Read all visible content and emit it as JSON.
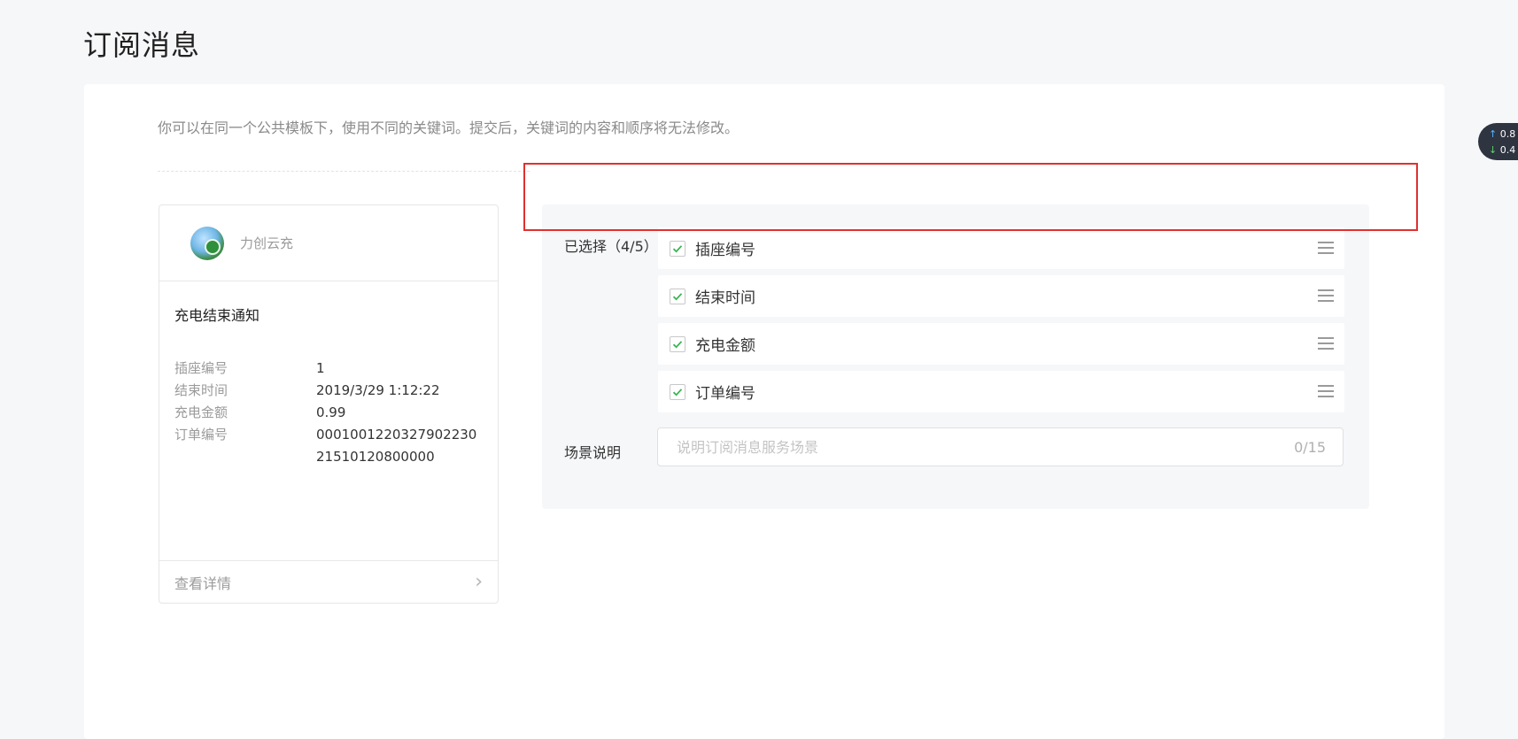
{
  "page": {
    "title": "订阅消息"
  },
  "hint": "你可以在同一个公共模板下，使用不同的关键词。提交后，关键词的内容和顺序将无法修改。",
  "preview": {
    "app_name": "力创云充",
    "message_title": "充电结束通知",
    "fields": [
      {
        "label": "插座编号",
        "value": "1"
      },
      {
        "label": "结束时间",
        "value": "2019/3/29 1:12:22"
      },
      {
        "label": "充电金额",
        "value": "0.99"
      },
      {
        "label": "订单编号",
        "value": "000100122032790223021510120800000"
      }
    ],
    "footer_link": "查看详情"
  },
  "editor": {
    "selected_label": "已选择（4/5）",
    "keywords": [
      {
        "label": "插座编号",
        "checked": true
      },
      {
        "label": "结束时间",
        "checked": true
      },
      {
        "label": "充电金额",
        "checked": true
      },
      {
        "label": "订单编号",
        "checked": true
      }
    ],
    "scene_label": "场景说明",
    "scene_placeholder": "说明订阅消息服务场景",
    "scene_counter": "0/15"
  },
  "net_widget": {
    "up": "0.8",
    "down": "0.4"
  },
  "colors": {
    "check": "#3cb553",
    "annotation": "#e03030"
  }
}
